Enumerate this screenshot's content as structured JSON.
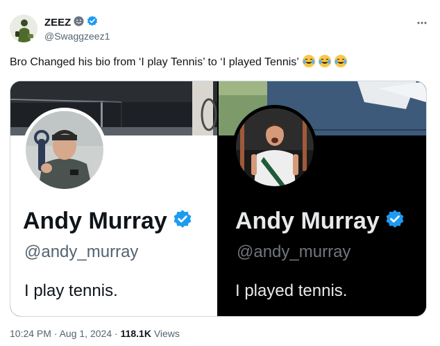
{
  "tweet": {
    "author": {
      "display_name": "ZEEZ",
      "handle": "@Swaggzeez1"
    },
    "more_icon": "more-dots-icon",
    "text": "Bro Changed his bio from ‘I play Tennis’ to ‘I played Tennis’",
    "emoji": [
      "laughing-tears-emoji",
      "laughing-tears-emoji",
      "laughing-tears-emoji"
    ],
    "timestamp": "10:24 PM · Aug 1, 2024",
    "separator": " · ",
    "views_count": "118.1K",
    "views_label": " Views"
  },
  "media": {
    "left": {
      "name": "Andy Murray",
      "handle": "@andy_murray",
      "bio": "I play tennis."
    },
    "right": {
      "name": "Andy Murray",
      "handle": "@andy_murray",
      "bio": "I played tennis."
    }
  },
  "colors": {
    "verified": "#1d9bf0",
    "text_primary": "#0f1419",
    "text_secondary": "#536471",
    "dark_bg": "#000000"
  }
}
